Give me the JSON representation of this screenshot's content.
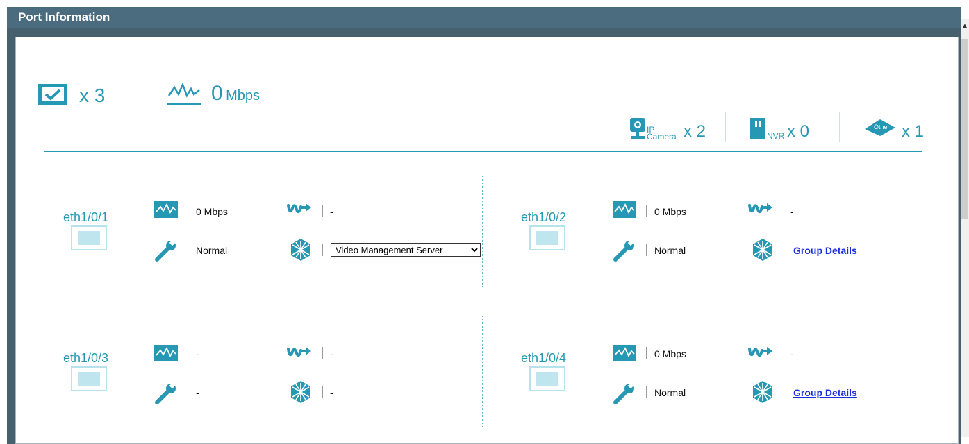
{
  "panel": {
    "title": "Port Information"
  },
  "summary": {
    "linked_count": "x 3",
    "throughput_value": "0",
    "throughput_unit": "Mbps"
  },
  "devices": {
    "ip_camera": {
      "label_top": "IP",
      "label_bottom": "Camera",
      "count": "x 2"
    },
    "nvr": {
      "label": "NVR",
      "count": "x 0"
    },
    "other": {
      "label": "Other",
      "count": "x 1"
    }
  },
  "ports": [
    {
      "name": "eth1/0/1",
      "traffic": "0 Mbps",
      "poe": "-",
      "status": "Normal",
      "group": "",
      "group_select": "Video Management Server"
    },
    {
      "name": "eth1/0/2",
      "traffic": "0 Mbps",
      "poe": "-",
      "status": "Normal",
      "group": "Group Details"
    },
    {
      "name": "eth1/0/3",
      "traffic": "-",
      "poe": "-",
      "status": "-",
      "group": "-"
    },
    {
      "name": "eth1/0/4",
      "traffic": "0 Mbps",
      "poe": "-",
      "status": "Normal",
      "group": "Group Details"
    }
  ],
  "colors": {
    "accent": "#2798b3",
    "titlebar": "#4b6b7e",
    "link": "#1a2edb"
  }
}
